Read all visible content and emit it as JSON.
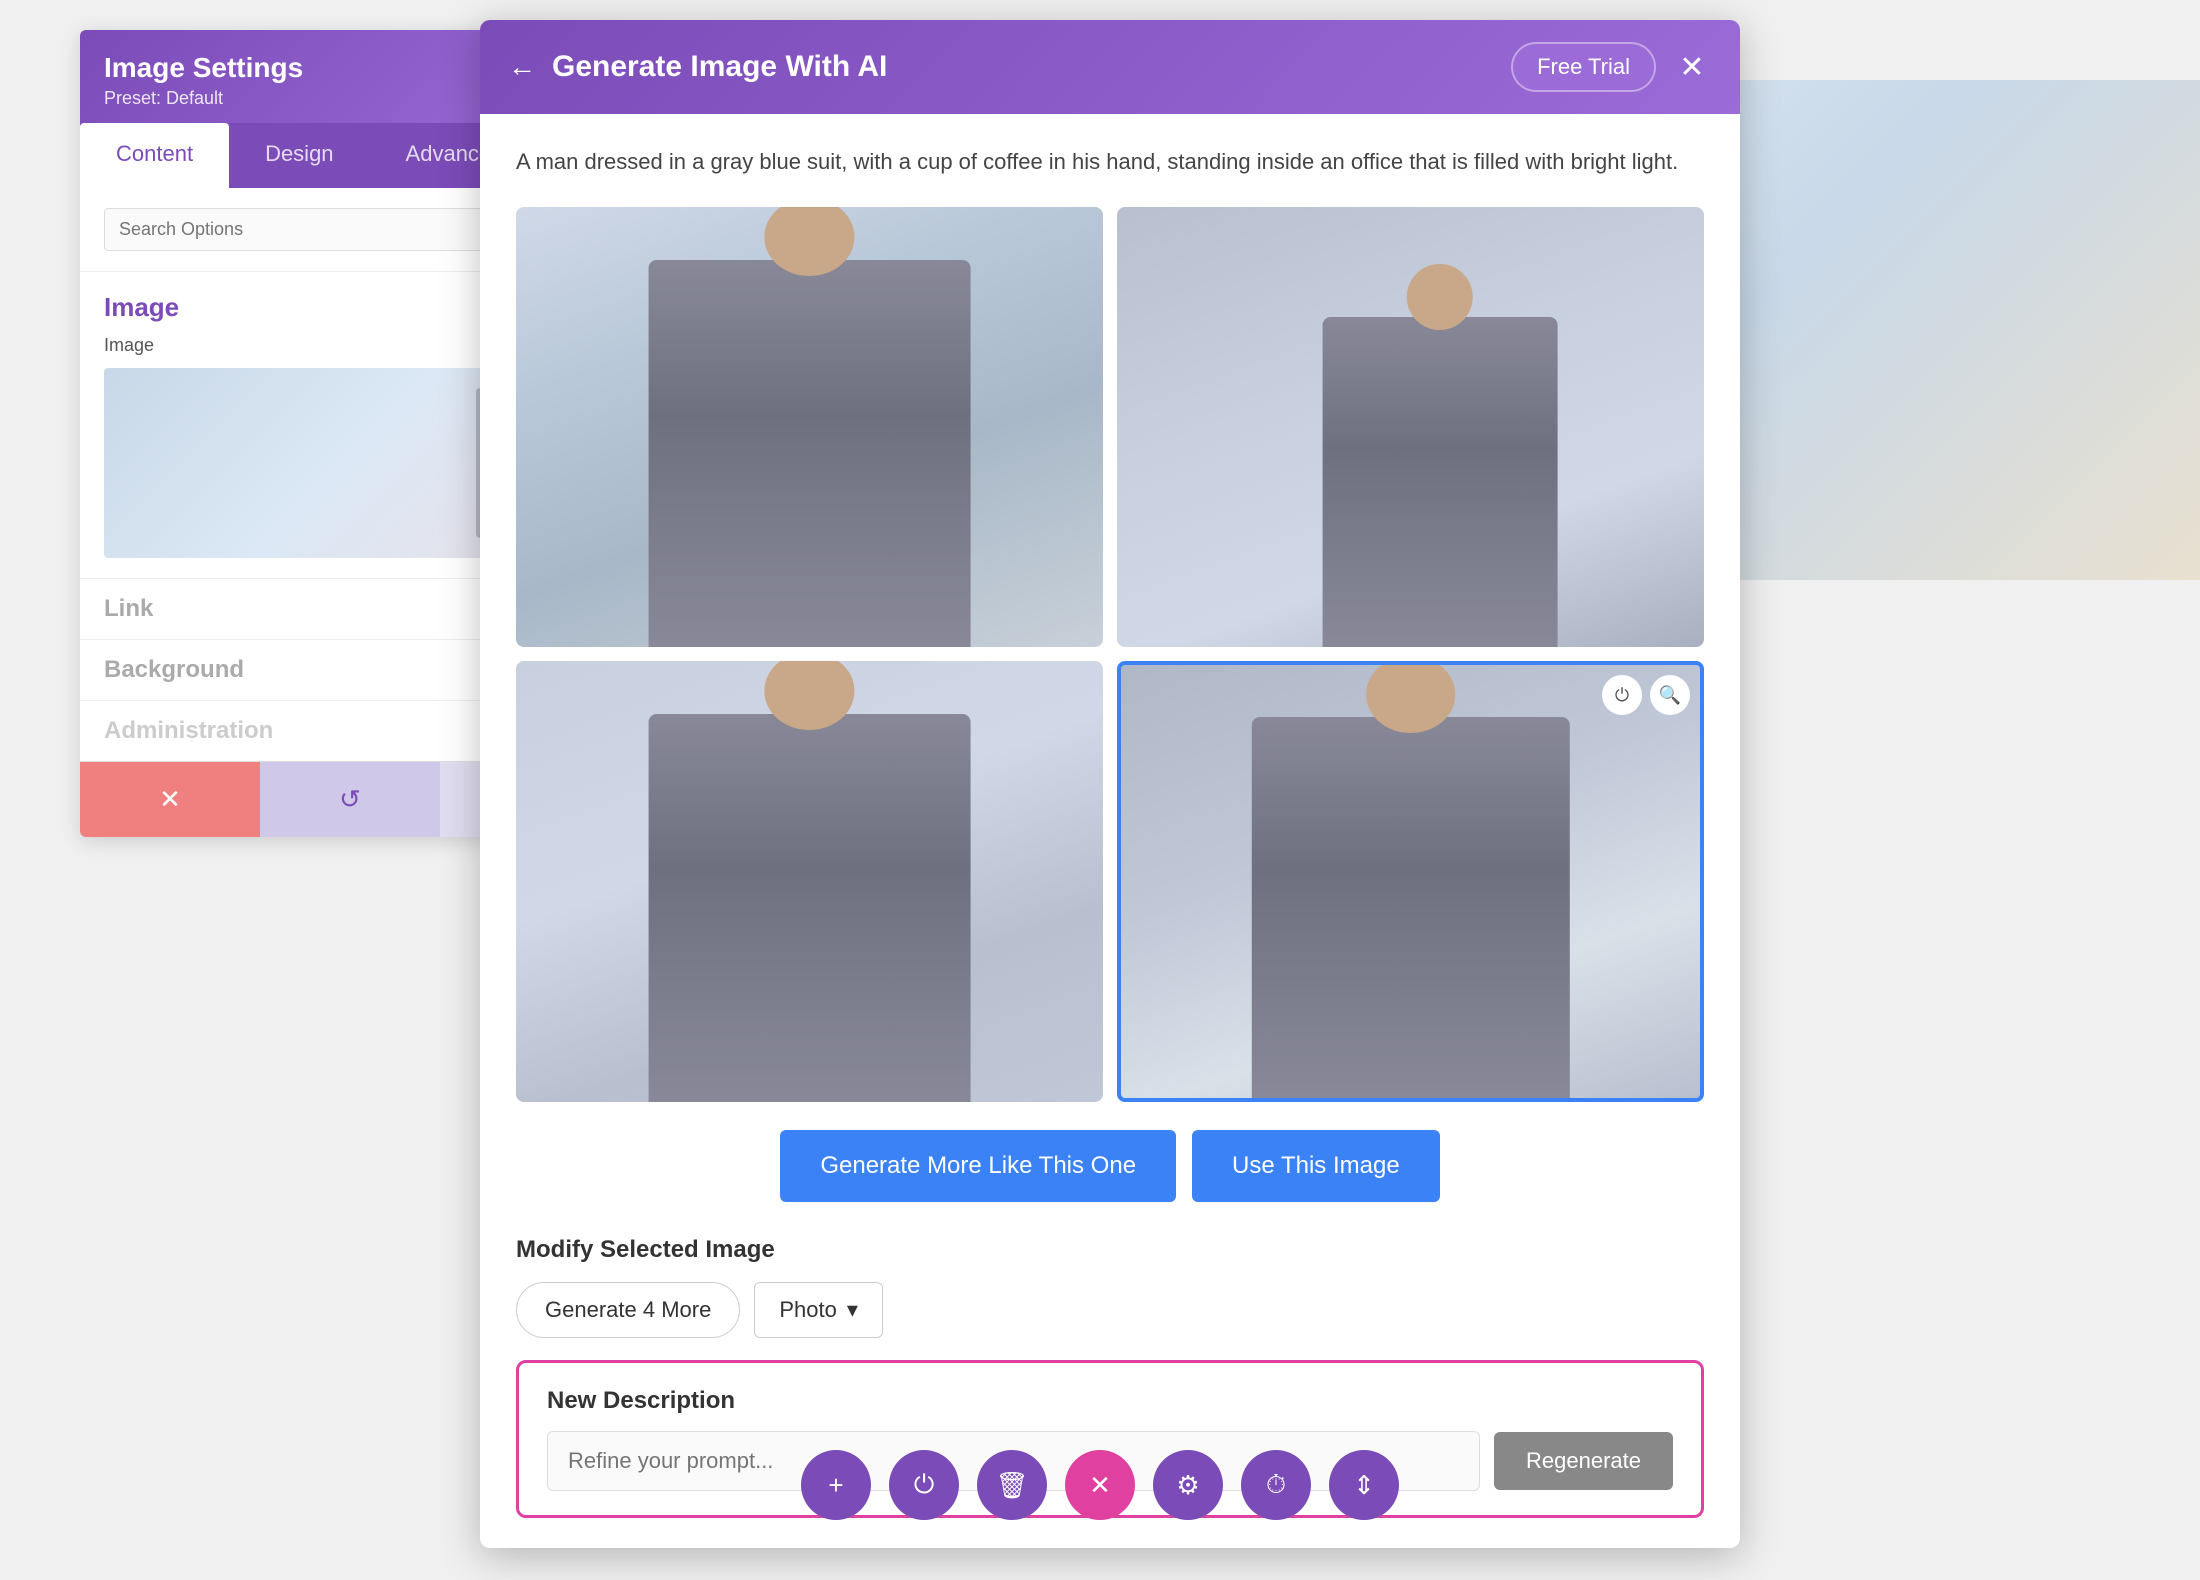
{
  "page": {
    "background_color": "#e8e8e8"
  },
  "image_settings_panel": {
    "title": "Image Settings",
    "preset_label": "Preset: Default",
    "settings_icon": "gear-icon",
    "tabs": [
      {
        "label": "Content",
        "active": true
      },
      {
        "label": "Design",
        "active": false
      },
      {
        "label": "Advanced",
        "active": false
      }
    ],
    "search_placeholder": "Search Options",
    "section_image_title": "Image",
    "section_image_label": "Image",
    "section_link_title": "Link",
    "section_background_title": "Background",
    "section_adv_title": "Administration",
    "bottom_cancel": "✕",
    "bottom_reset": "↺",
    "bottom_apply": "↻"
  },
  "ai_modal": {
    "back_icon": "back-arrow-icon",
    "title": "Generate Image With AI",
    "free_trial_label": "Free Trial",
    "close_icon": "close-icon",
    "description": "A man dressed in a gray blue suit, with a cup of coffee in his hand, standing inside an office that is filled with bright light.",
    "images": [
      {
        "id": 1,
        "alt": "Man in suit with coffee, office 1",
        "selected": false
      },
      {
        "id": 2,
        "alt": "Man in suit walking in office",
        "selected": false
      },
      {
        "id": 3,
        "alt": "Man in suit holding cup, office 3",
        "selected": false
      },
      {
        "id": 4,
        "alt": "Man in suit in office with city view",
        "selected": true
      }
    ],
    "selected_overlay_power": "⏻",
    "selected_overlay_search": "🔍",
    "btn_generate_more": "Generate More Like This One",
    "btn_use_image": "Use This Image",
    "modify_title": "Modify Selected Image",
    "btn_generate_4_more": "Generate 4 More",
    "style_select_value": "Photo",
    "style_select_chevron": "▾",
    "new_desc_title": "New Description",
    "new_desc_placeholder": "Refine your prompt...",
    "btn_regenerate": "Regenerate"
  },
  "bottom_toolbar": {
    "buttons": [
      {
        "icon": "+",
        "name": "add-button",
        "active": false
      },
      {
        "icon": "⏻",
        "name": "power-button",
        "active": false
      },
      {
        "icon": "🗑",
        "name": "delete-button",
        "active": false
      },
      {
        "icon": "✕",
        "name": "close-active-button",
        "active": true
      },
      {
        "icon": "⚙",
        "name": "settings-button",
        "active": false
      },
      {
        "icon": "⏱",
        "name": "history-button",
        "active": false
      },
      {
        "icon": "⇕",
        "name": "resize-button",
        "active": false
      }
    ]
  }
}
